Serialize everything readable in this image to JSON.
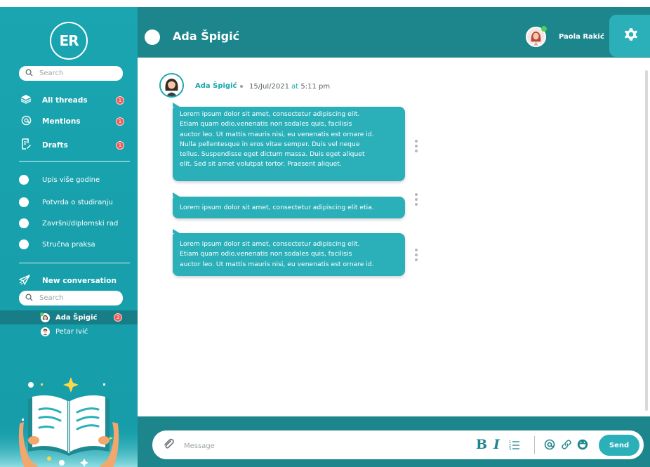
{
  "sidebar": {
    "logo_text": "ER",
    "search_placeholder": "Search",
    "nav": [
      {
        "label": "All threads",
        "icon": "layers-icon",
        "badge": "1"
      },
      {
        "label": "Mentions",
        "icon": "at-sign-icon",
        "badge": "1"
      },
      {
        "label": "Drafts",
        "icon": "draft-edit-icon",
        "badge": "1"
      }
    ],
    "threads": [
      {
        "label": "Upis više godine"
      },
      {
        "label": "Potvrda o studiranju"
      },
      {
        "label": "Završni/diplomski rad"
      },
      {
        "label": "Stručna praksa"
      }
    ],
    "new_conversation": "New conversation",
    "contacts_search_placeholder": "Search",
    "contacts": [
      {
        "name": "Ada Špigić",
        "badge": "3",
        "active": true,
        "online": true
      },
      {
        "name": "Petar Ivić",
        "active": false,
        "online": false
      }
    ]
  },
  "header": {
    "title": "Ada Špigić",
    "user_name": "Paola Rakić",
    "settings_icon": "gear-icon"
  },
  "conversation": {
    "author": "Ada Špigić",
    "date": "15/Jul/2021",
    "at": "at",
    "time": "5:11 pm",
    "messages": [
      {
        "lines": [
          "Lorem ipsum dolor sit amet, consectetur adipiscing elit.",
          "Etiam quam odio.venenatis non sodales quis, facilisis",
          "auctor leo. Ut mattis mauris nisi, eu venenatis est ornare id.",
          "Nulla pellentesque in eros vitae semper. Duis vel neque",
          "tellus. Suspendisse eget dictum massa. Duis eget aliquet",
          "elit. Sed sit amet volutpat tortor. Praesent aliquet."
        ]
      },
      {
        "lines": [
          "Lorem ipsum dolor sit amet, consectetur adipiscing elit etia."
        ]
      },
      {
        "lines": [
          "Lorem ipsum dolor sit amet, consectetur adipiscing elit.",
          "Etiam quam odio.venenatis non sodales quis, facilisis",
          "auctor leo. Ut mattis mauris nisi, eu venenatis est ornare id."
        ]
      }
    ]
  },
  "composer": {
    "placeholder": "Message",
    "bold_label": "B",
    "italic_label": "I",
    "send_label": "Send",
    "tools": [
      "attach-icon",
      "bold-icon",
      "italic-icon",
      "list-icon",
      "mention-icon",
      "link-icon",
      "emoji-icon"
    ]
  },
  "colors": {
    "sidebar": "#1aa5b0",
    "header": "#1d868d",
    "bubble": "#2bb0ba",
    "badge": "#ef5b5b",
    "online": "#4ccf5b"
  }
}
